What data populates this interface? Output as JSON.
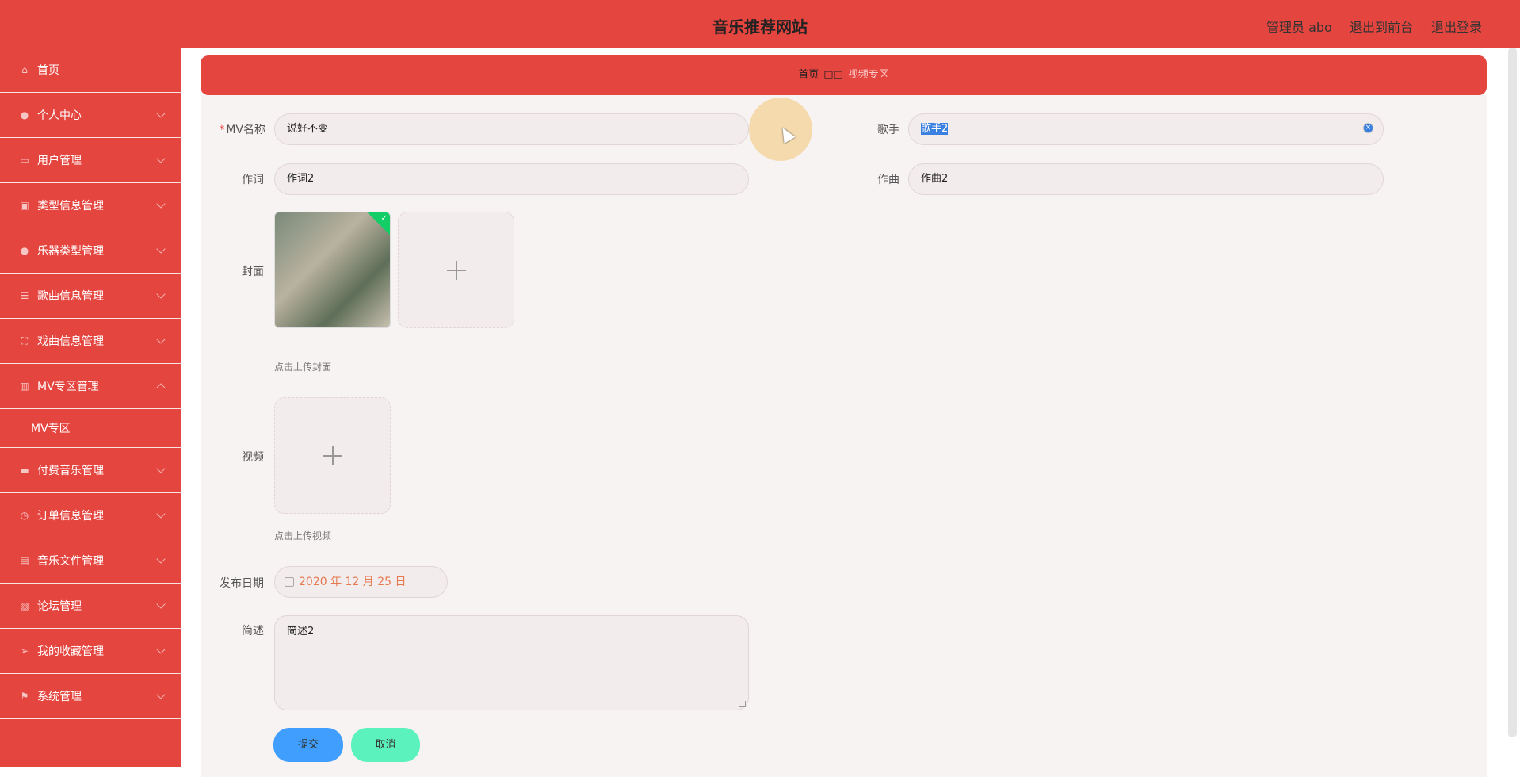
{
  "header": {
    "title": "音乐推荐网站",
    "user_label": "管理员 abo",
    "front_link": "退出到前台",
    "logout_link": "退出登录"
  },
  "sidebar": {
    "items": [
      {
        "label": "首页",
        "icon": "home-icon",
        "chevron": false
      },
      {
        "label": "个人中心",
        "icon": "user-icon",
        "chevron": true
      },
      {
        "label": "用户管理",
        "icon": "id-card-icon",
        "chevron": true
      },
      {
        "label": "类型信息管理",
        "icon": "image-icon",
        "chevron": true
      },
      {
        "label": "乐器类型管理",
        "icon": "location-icon",
        "chevron": true
      },
      {
        "label": "歌曲信息管理",
        "icon": "sliders-icon",
        "chevron": true
      },
      {
        "label": "戏曲信息管理",
        "icon": "fullscreen-icon",
        "chevron": true
      },
      {
        "label": "MV专区管理",
        "icon": "data-icon",
        "chevron": true,
        "expanded": true,
        "sub": [
          "MV专区"
        ]
      },
      {
        "label": "付费音乐管理",
        "icon": "monitor-icon",
        "chevron": true
      },
      {
        "label": "订单信息管理",
        "icon": "clock-icon",
        "chevron": true
      },
      {
        "label": "音乐文件管理",
        "icon": "doc-icon",
        "chevron": true
      },
      {
        "label": "论坛管理",
        "icon": "clipboard-icon",
        "chevron": true
      },
      {
        "label": "我的收藏管理",
        "icon": "send-icon",
        "chevron": true
      },
      {
        "label": "系统管理",
        "icon": "flag-icon",
        "chevron": true
      }
    ]
  },
  "breadcrumb": {
    "home": "首页",
    "separator": "□□",
    "current": "视频专区"
  },
  "form": {
    "mv_name": {
      "label": "MV名称",
      "required_mark": "*",
      "value": "说好不变"
    },
    "singer": {
      "label": "歌手",
      "value": "歌手2"
    },
    "lyricist": {
      "label": "作词",
      "value": "作词2"
    },
    "composer": {
      "label": "作曲",
      "value": "作曲2"
    },
    "cover": {
      "label": "封面",
      "hint": "点击上传封面"
    },
    "video": {
      "label": "视频",
      "hint": "点击上传视频"
    },
    "release_date": {
      "label": "发布日期",
      "value": "2020 年 12 月 25 日"
    },
    "summary": {
      "label": "简述",
      "value": "简述2"
    },
    "submit_label": "提交",
    "cancel_label": "取消"
  },
  "colors": {
    "primary": "#e5453f",
    "submit": "#409eff",
    "cancel": "#5cf2bd",
    "success": "#13ce66"
  }
}
